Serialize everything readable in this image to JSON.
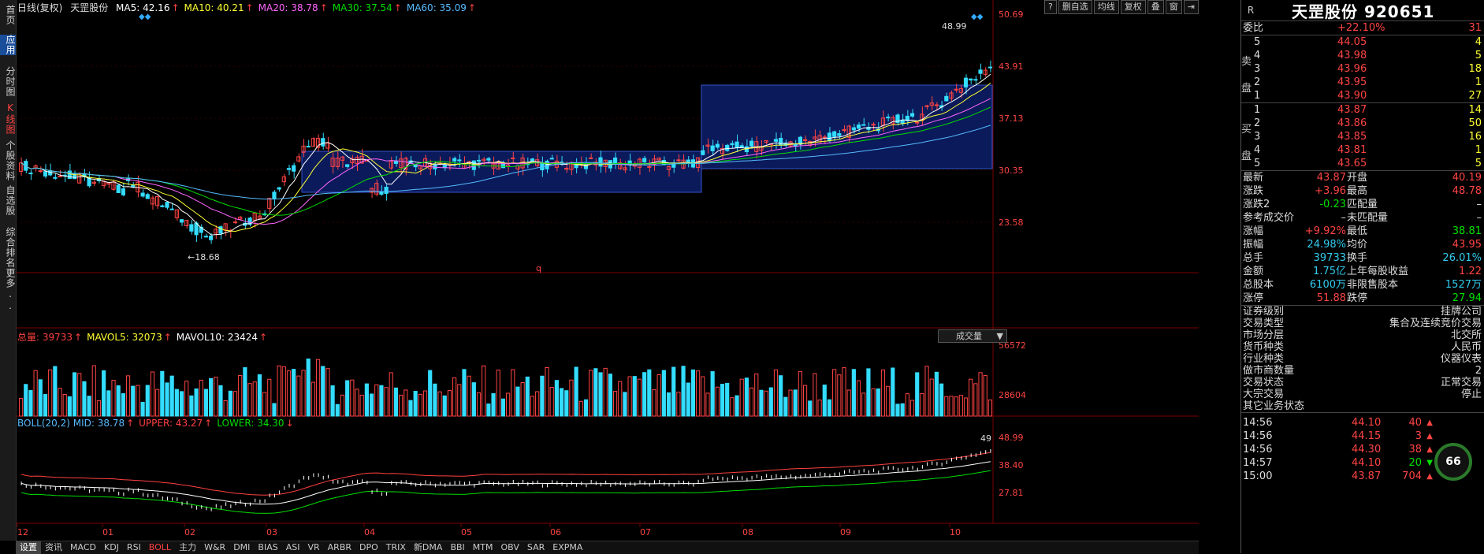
{
  "leftbar": [
    {
      "label": "首页",
      "state": ""
    },
    {
      "label": "应用",
      "state": "sel"
    },
    {
      "label": "分时图",
      "state": ""
    },
    {
      "label": "K线图",
      "state": "active"
    },
    {
      "label": "个股资料",
      "state": ""
    },
    {
      "label": "自选股",
      "state": ""
    },
    {
      "label": "综合排名",
      "state": ""
    },
    {
      "label": "更多..",
      "state": ""
    }
  ],
  "header": {
    "period": "日线(复权)",
    "stock": "天罡股份",
    "ma": [
      {
        "label": "MA5: 42.16",
        "color": "#ffffff",
        "arrow": "↑"
      },
      {
        "label": "MA10: 40.21",
        "color": "#ffff33",
        "arrow": "↑"
      },
      {
        "label": "MA20: 38.78",
        "color": "#ff66ff",
        "arrow": "↑"
      },
      {
        "label": "MA30: 37.54",
        "color": "#00dd00",
        "arrow": "↑"
      },
      {
        "label": "MA60: 35.09",
        "color": "#55bbff",
        "arrow": "↑"
      }
    ]
  },
  "toolbar": [
    "?",
    "删自选",
    "均线",
    "复权",
    "叠",
    "窗",
    "⇥"
  ],
  "price_axis": [
    "50.69",
    "43.91",
    "37.13",
    "30.35",
    "23.58"
  ],
  "annotations": {
    "high": "48.99",
    "low": "←18.68",
    "q": "q"
  },
  "volume": {
    "legend": [
      {
        "label": "总量: 39733",
        "color": "#ff4040",
        "arrow": "↑"
      },
      {
        "label": "MAVOL5: 32073",
        "color": "#ffff33",
        "arrow": "↑"
      },
      {
        "label": "MAVOL10: 23424",
        "color": "#ffffff",
        "arrow": "↑"
      }
    ],
    "selector": "成交量",
    "axis": [
      "56572",
      "28604"
    ]
  },
  "boll": {
    "legend": [
      {
        "label": "BOLL(20,2) MID: 38.78",
        "color": "#55bbff",
        "arrow": "↑"
      },
      {
        "label": "UPPER: 43.27",
        "color": "#ff4040",
        "arrow": "↑"
      },
      {
        "label": "LOWER: 34.30",
        "color": "#00dd00",
        "arrow": "↓"
      }
    ],
    "axis": [
      "48.99",
      "38.40",
      "27.81"
    ],
    "tip": "49"
  },
  "months": [
    "12",
    "01",
    "02",
    "03",
    "04",
    "05",
    "06",
    "07",
    "08",
    "09",
    "10"
  ],
  "bottom_tabs": [
    "设置",
    "资讯",
    "MACD",
    "KDJ",
    "RSI",
    "BOLL",
    "主力",
    "W&R",
    "DMI",
    "BIAS",
    "ASI",
    "VR",
    "ARBR",
    "DPO",
    "TRIX",
    "新DMA",
    "BBI",
    "MTM",
    "OBV",
    "SAR",
    "EXPMA"
  ],
  "bottom_active": "BOLL",
  "panel": {
    "r": "R",
    "title": "天罡股份  920651",
    "weibi": {
      "label": "委比",
      "pct": "+22.10%",
      "val": "31"
    },
    "sell": [
      {
        "n": "5",
        "price": "44.05",
        "vol": "4"
      },
      {
        "n": "4",
        "price": "43.98",
        "vol": "5"
      },
      {
        "n": "3",
        "price": "43.96",
        "vol": "18"
      },
      {
        "n": "2",
        "price": "43.95",
        "vol": "1"
      },
      {
        "n": "1",
        "price": "43.90",
        "vol": "27"
      }
    ],
    "sell_label": [
      "卖",
      "盘"
    ],
    "buy": [
      {
        "n": "1",
        "price": "43.87",
        "vol": "14"
      },
      {
        "n": "2",
        "price": "43.86",
        "vol": "50"
      },
      {
        "n": "3",
        "price": "43.85",
        "vol": "16"
      },
      {
        "n": "4",
        "price": "43.81",
        "vol": "1"
      },
      {
        "n": "5",
        "price": "43.65",
        "vol": "5"
      }
    ],
    "buy_label": [
      "买",
      "盘"
    ],
    "quote": [
      {
        "l1": "最新",
        "v1": "43.87",
        "c1": "red",
        "l2": "开盘",
        "v2": "40.19",
        "c2": "red"
      },
      {
        "l1": "涨跌",
        "v1": "+3.96",
        "c1": "red",
        "l2": "最高",
        "v2": "48.78",
        "c2": "red"
      },
      {
        "l1": "涨跌2",
        "v1": "-0.23",
        "c1": "grn",
        "l2": "匹配量",
        "v2": "–",
        "c2": "wht"
      },
      {
        "l1": "参考成交价",
        "v1": "–",
        "c1": "wht",
        "l2": "未匹配量",
        "v2": "–",
        "c2": "wht"
      },
      {
        "l1": "涨幅",
        "v1": "+9.92%",
        "c1": "red",
        "l2": "最低",
        "v2": "38.81",
        "c2": "grn"
      },
      {
        "l1": "振幅",
        "v1": "24.98%",
        "c1": "cy",
        "l2": "均价",
        "v2": "43.95",
        "c2": "red"
      },
      {
        "l1": "总手",
        "v1": "39733",
        "c1": "cy",
        "l2": "换手",
        "v2": "26.01%",
        "c2": "cy"
      },
      {
        "l1": "金额",
        "v1": "1.75亿",
        "c1": "cy",
        "l2": "上年每股收益",
        "v2": "1.22",
        "c2": "red"
      },
      {
        "l1": "总股本",
        "v1": "6100万",
        "c1": "cy",
        "l2": "非限售股本",
        "v2": "1527万",
        "c2": "cy"
      },
      {
        "l1": "涨停",
        "v1": "51.88",
        "c1": "red",
        "l2": "跌停",
        "v2": "27.94",
        "c2": "grn"
      }
    ],
    "info": [
      {
        "k": "证券级别",
        "v": "挂牌公司"
      },
      {
        "k": "交易类型",
        "v": "集合及连续竞价交易"
      },
      {
        "k": "市场分层",
        "v": "北交所"
      },
      {
        "k": "货币种类",
        "v": "人民币"
      },
      {
        "k": "行业种类",
        "v": "仪器仪表"
      },
      {
        "k": "做市商数量",
        "v": "2"
      },
      {
        "k": "交易状态",
        "v": "正常交易"
      },
      {
        "k": "大宗交易",
        "v": "停止"
      },
      {
        "k": "其它业务状态",
        "v": ""
      }
    ],
    "gauge": "66",
    "ticks": [
      {
        "t": "14:56",
        "p": "44.10",
        "v": "40",
        "up": true
      },
      {
        "t": "14:56",
        "p": "44.15",
        "v": "3",
        "up": true
      },
      {
        "t": "14:56",
        "p": "44.30",
        "v": "38",
        "up": true
      },
      {
        "t": "14:57",
        "p": "44.10",
        "v": "20",
        "up": false
      },
      {
        "t": "15:00",
        "p": "43.87",
        "v": "704",
        "up": true
      }
    ]
  },
  "colors": {
    "up": "#ff4444",
    "down": "#33ddff",
    "box": "#0b1a5a"
  }
}
